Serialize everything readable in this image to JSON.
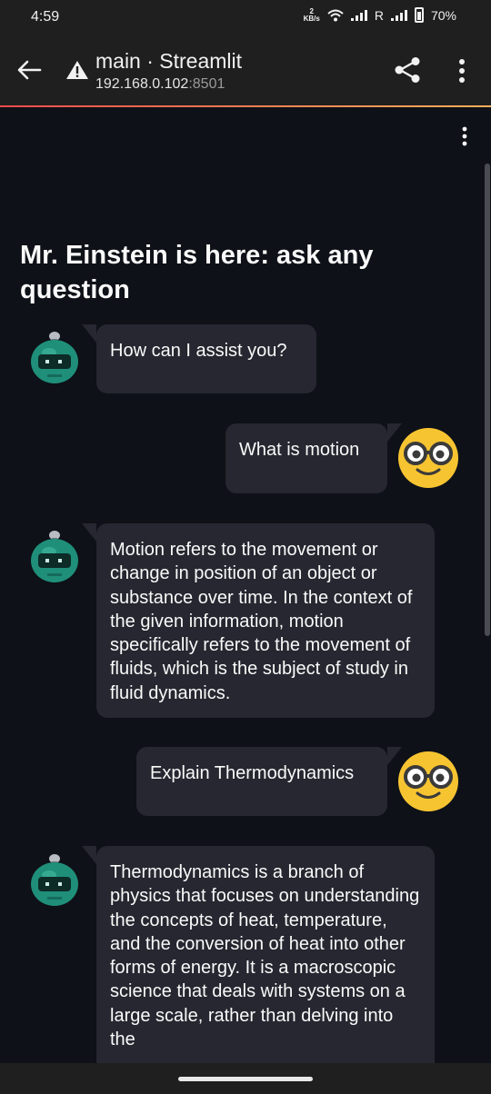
{
  "status_bar": {
    "time": "4:59",
    "speed_value": "2",
    "speed_unit": "KB/s",
    "roaming": "R",
    "battery": "70%"
  },
  "browser": {
    "title": "main · Streamlit",
    "url_host": "192.168.0.102",
    "url_port": ":8501",
    "icons": [
      "back-arrow-icon",
      "warning-icon",
      "share-icon",
      "more-vert-icon"
    ]
  },
  "page": {
    "title": "Mr. Einstein is here: ask any question"
  },
  "messages": [
    {
      "role": "assistant",
      "text": "How can I assist you?"
    },
    {
      "role": "user",
      "text": "What is motion"
    },
    {
      "role": "assistant",
      "text": "Motion refers to the movement or change in position of an object or substance over time. In the context of the given information, motion specifically refers to the movement of fluids, which is the subject of study in fluid dynamics."
    },
    {
      "role": "user",
      "text": "Explain Thermodynamics"
    },
    {
      "role": "assistant",
      "text": "Thermodynamics is a branch of physics that focuses on understanding the concepts of heat, temperature, and the conversion of heat into other forms of energy. It is a macroscopic science that deals with systems on a large scale, rather than delving into the"
    }
  ],
  "colors": {
    "background": "#0e1117",
    "bubble": "#262730",
    "browser_bar": "#1f1f1f",
    "bot_avatar": "#1f8f7a",
    "user_avatar": "#f7c431"
  }
}
